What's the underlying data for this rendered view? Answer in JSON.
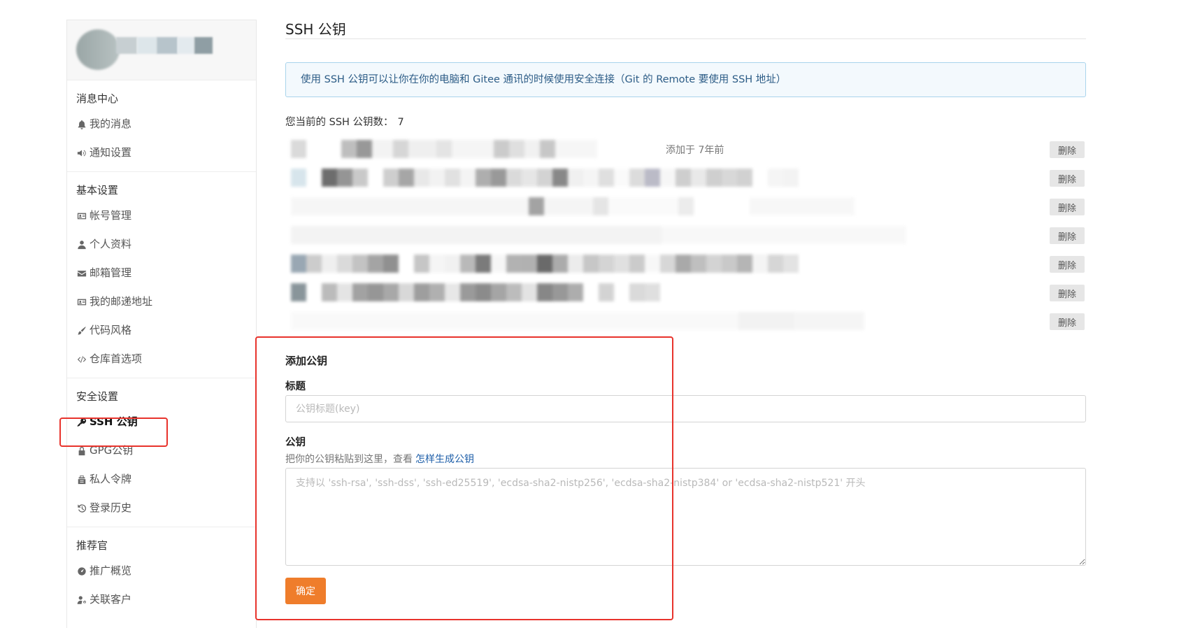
{
  "sidebar": {
    "sections": [
      {
        "title": "消息中心",
        "items": [
          {
            "label": "我的消息",
            "icon": "bell-icon"
          },
          {
            "label": "通知设置",
            "icon": "speaker-icon"
          }
        ]
      },
      {
        "title": "基本设置",
        "items": [
          {
            "label": "帐号管理",
            "icon": "id-card-icon"
          },
          {
            "label": "个人资料",
            "icon": "user-icon"
          },
          {
            "label": "邮箱管理",
            "icon": "envelope-icon"
          },
          {
            "label": "我的邮递地址",
            "icon": "address-card-icon"
          },
          {
            "label": "代码风格",
            "icon": "brush-icon"
          },
          {
            "label": "仓库首选项",
            "icon": "code-icon"
          }
        ]
      },
      {
        "title": "安全设置",
        "items": [
          {
            "label": "SSH 公钥",
            "icon": "key-icon",
            "active": true
          },
          {
            "label": "GPG公钥",
            "icon": "lock-icon"
          },
          {
            "label": "私人令牌",
            "icon": "token-icon"
          },
          {
            "label": "登录历史",
            "icon": "history-icon"
          }
        ]
      },
      {
        "title": "推荐官",
        "items": [
          {
            "label": "推广概览",
            "icon": "dashboard-icon"
          },
          {
            "label": "关联客户",
            "icon": "user-link-icon"
          }
        ]
      }
    ]
  },
  "main": {
    "page_title": "SSH 公钥",
    "info": "使用 SSH 公钥可以让你在你的电脑和 Gitee 通讯的时候使用安全连接（Git 的 Remote 要使用 SSH 地址）",
    "key_count_label": "您当前的 SSH 公钥数：",
    "key_count": "7",
    "keys": [
      {
        "meta": "添加于 7年前",
        "delete_label": "删除"
      },
      {
        "meta": "",
        "delete_label": "删除"
      },
      {
        "meta": "",
        "delete_label": "删除"
      },
      {
        "meta": "",
        "delete_label": "删除"
      },
      {
        "meta": "",
        "delete_label": "删除"
      },
      {
        "meta": "",
        "delete_label": "删除"
      },
      {
        "meta": "",
        "delete_label": "删除"
      }
    ],
    "form": {
      "heading": "添加公钥",
      "title_label": "标题",
      "title_placeholder": "公钥标题(key)",
      "key_label": "公钥",
      "help_text": "把你的公钥粘贴到这里，查看",
      "help_link": "怎样生成公钥",
      "key_placeholder": "支持以 'ssh-rsa', 'ssh-dss', 'ssh-ed25519', 'ecdsa-sha2-nistp256', 'ecdsa-sha2-nistp384' or 'ecdsa-sha2-nistp521' 开头",
      "submit_label": "确定"
    }
  },
  "colors": {
    "accent": "#ef7d2b",
    "annotation": "#e8332c",
    "info_border": "#a9d4ec",
    "info_bg": "#f3f9fd",
    "link": "#1d5ea8"
  }
}
